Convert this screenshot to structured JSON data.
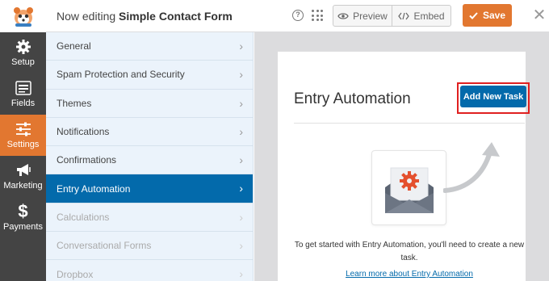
{
  "header": {
    "editing_prefix": "Now editing",
    "form_name": "Simple Contact Form",
    "help_icon": "help-circle-icon",
    "grid_icon": "apps-grid-icon",
    "preview_label": "Preview",
    "embed_label": "Embed",
    "save_label": "Save",
    "close_icon": "close-icon"
  },
  "iconbar": {
    "items": [
      {
        "label": "Setup",
        "icon": "gear-icon"
      },
      {
        "label": "Fields",
        "icon": "fields-list-icon"
      },
      {
        "label": "Settings",
        "icon": "sliders-icon",
        "active": true
      },
      {
        "label": "Marketing",
        "icon": "megaphone-icon"
      },
      {
        "label": "Payments",
        "icon": "dollar-icon"
      }
    ]
  },
  "settings_panel": {
    "items": [
      {
        "label": "General",
        "state": "normal"
      },
      {
        "label": "Spam Protection and Security",
        "state": "normal"
      },
      {
        "label": "Themes",
        "state": "normal"
      },
      {
        "label": "Notifications",
        "state": "normal"
      },
      {
        "label": "Confirmations",
        "state": "normal"
      },
      {
        "label": "Entry Automation",
        "state": "active"
      },
      {
        "label": "Calculations",
        "state": "disabled"
      },
      {
        "label": "Conversational Forms",
        "state": "disabled"
      },
      {
        "label": "Dropbox",
        "state": "disabled"
      }
    ]
  },
  "main": {
    "title": "Entry Automation",
    "add_button_label": "Add New Task",
    "description": "To get started with Entry Automation, you'll need to create a new task.",
    "learn_more": "Learn more about Entry Automation"
  },
  "colors": {
    "accent_orange": "#e27730",
    "primary_blue": "#036aab",
    "highlight_red": "#e02020",
    "sidebar_dark": "#444444",
    "panel_bg": "#ebf3fb"
  }
}
